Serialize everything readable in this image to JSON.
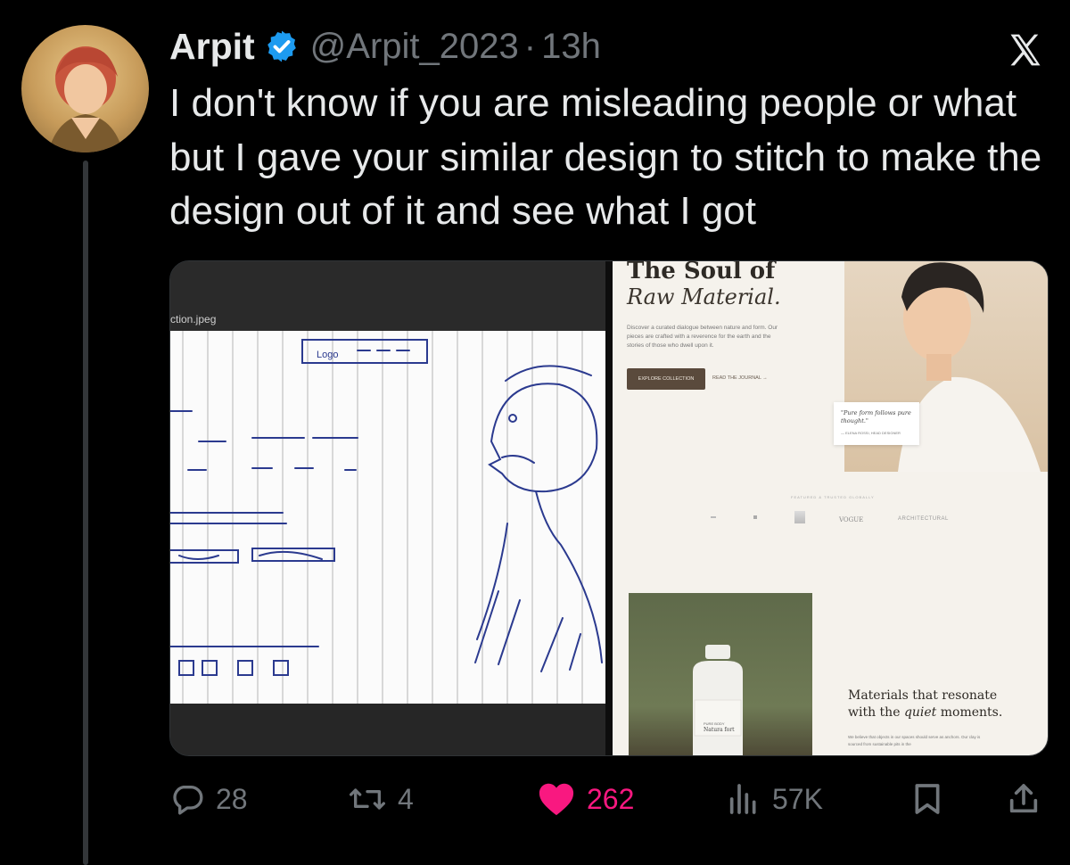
{
  "author": {
    "name": "Arpit",
    "handle": "@Arpit_2023",
    "separator": "·",
    "time": "13h"
  },
  "tweet": {
    "text": "I don't know if you are misleading people or what but I gave your similar design to stitch to make the design out of it and see what I got"
  },
  "media": {
    "left_filename": "ction.jpeg",
    "sketch_logo_label": "Logo",
    "right": {
      "title": "The Soul of",
      "subtitle": "Raw Material.",
      "description": "Discover a curated dialogue between nature and form. Our pieces are crafted with a reverence for the earth and the stories of those who dwell upon it.",
      "primary_button": "EXPLORE COLLECTION",
      "secondary_link": "READ THE JOURNAL →",
      "quote": "\"Pure form follows pure thought.\"",
      "quote_author": "— ELENA ROSSI, HEAD DESIGNER",
      "featured_label": "FEATURED & TRUSTED GLOBALLY",
      "logo_vogue": "VOGUE",
      "logo_architectural": "ARCHITECTURAL",
      "bottle_label_small": "PURE BODY",
      "bottle_label_main": "Natura fort",
      "materials_heading_1": "Materials that resonate",
      "materials_heading_2a": "with the ",
      "materials_heading_2b": "quiet",
      "materials_heading_2c": " moments.",
      "materials_desc": "We believe that objects in our spaces should serve as anchors. Our clay is sourced from sustainable pits in the"
    }
  },
  "actions": {
    "replies": "28",
    "reposts": "4",
    "likes": "262",
    "views": "57K"
  },
  "colors": {
    "background": "#000000",
    "text": "#e7e9ea",
    "muted": "#71767b",
    "like": "#f91880",
    "verified": "#1d9bf0"
  },
  "icons": [
    "verified-badge-icon",
    "x-logo-icon",
    "reply-icon",
    "repost-icon",
    "heart-icon",
    "views-icon",
    "bookmark-icon",
    "share-icon"
  ]
}
